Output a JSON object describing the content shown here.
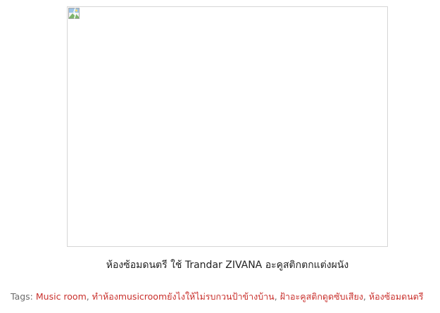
{
  "figure": {
    "caption": "ห้องซ้อมดนตรี ใช้ Trandar ZIVANA อะคูสติกตกแต่งผนัง",
    "image_icon": "broken-image-icon"
  },
  "tags": {
    "label": "Tags:",
    "items": [
      "Music room",
      "ทำห้องmusicroomยังไงให้ไม่รบกวนป้าข้างบ้าน",
      "ฝ้าอะคูสติกดูดซับเสียง",
      "ห้องซ้อมดนตรี"
    ],
    "separator": ",",
    "link_color": "#c9302c"
  }
}
